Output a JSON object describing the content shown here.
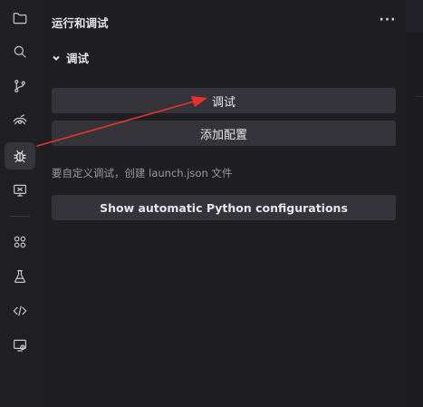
{
  "activity_bar": {
    "icons": [
      {
        "name": "explorer-icon"
      },
      {
        "name": "search-icon"
      },
      {
        "name": "source-control-icon"
      },
      {
        "name": "remote-explorer-icon"
      },
      {
        "name": "debug-icon",
        "active": true
      },
      {
        "name": "remote-monitor-icon"
      },
      {
        "name": "extensions-icon"
      },
      {
        "name": "testing-icon"
      },
      {
        "name": "code-icon"
      },
      {
        "name": "remote-desktop-icon"
      }
    ]
  },
  "sidebar": {
    "title": "运行和调试",
    "more_label": "···",
    "section": {
      "label": "调试"
    },
    "buttons": {
      "debug": "调试",
      "add_config": "添加配置",
      "python": "Show automatic Python configurations"
    },
    "hint": "要自定义调试，创建 launch.json 文件"
  },
  "colors": {
    "annotation_arrow": "#e8322e",
    "button_bg": "#34343a",
    "active_icon_bg": "#35353c"
  }
}
